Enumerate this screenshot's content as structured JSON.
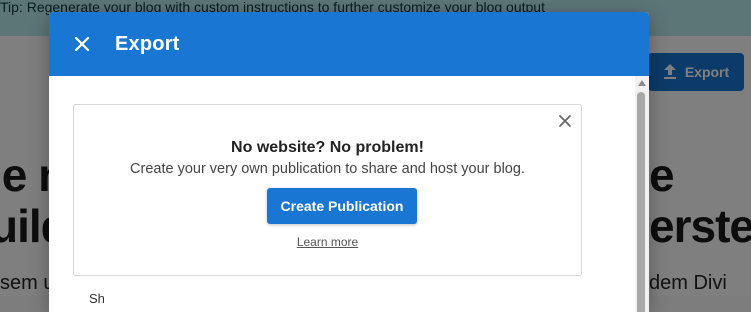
{
  "background": {
    "tip_text": "Tip: Regenerate your blog with custom instructions to further customize your blog output",
    "export_button_label": "Export",
    "heading_left_line1": "ie n",
    "heading_left_line2": "uild",
    "heading_right_line1": "e",
    "heading_right_line2": "erste",
    "body_left": "sem u",
    "body_right": "dem Divi"
  },
  "dialog": {
    "title": "Export",
    "promo": {
      "title": "No website? No problem!",
      "subtitle": "Create your very own publication to share and host your blog.",
      "button_label": "Create Publication",
      "learn_more": "Learn more"
    },
    "partial_next_text": "Sh"
  },
  "colors": {
    "primary": "#1976d2",
    "tip_background": "#b8ecef"
  }
}
